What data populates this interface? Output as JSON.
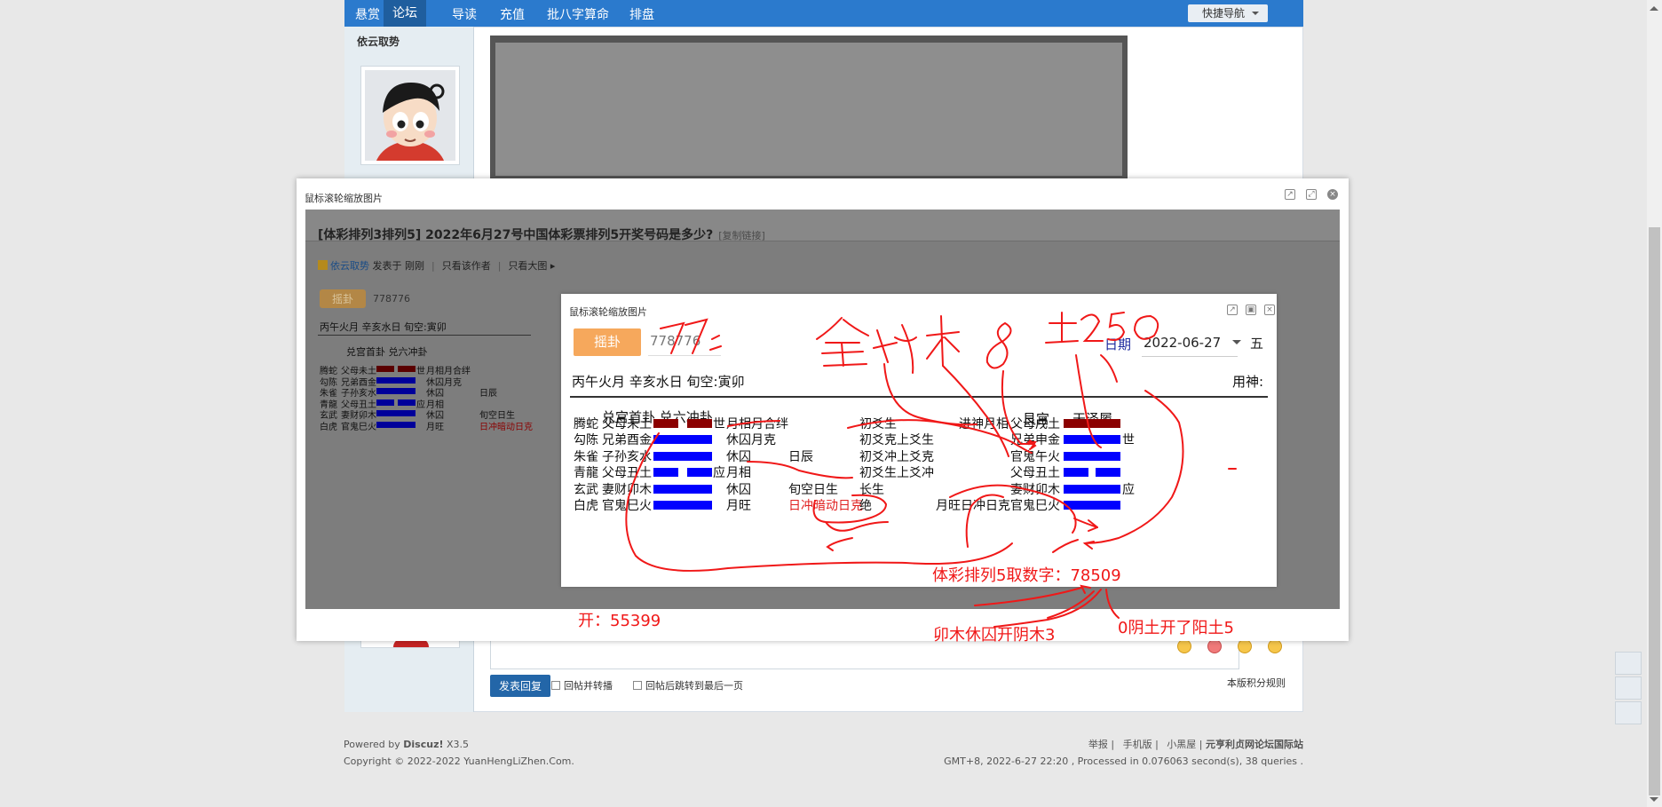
{
  "nav": {
    "items": [
      "悬赏",
      "论坛",
      "导读",
      "充值",
      "批八字算命",
      "排盘"
    ],
    "active_index": 1,
    "quick_nav": "快捷导航"
  },
  "sidebar": {
    "author": "依云取势"
  },
  "reply": {
    "submit": "发表回复",
    "opt1": "回帖并转播",
    "opt2": "回帖后跳转到最后一页",
    "rules": "本版积分规则"
  },
  "footer": {
    "powered_prefix": "Powered by ",
    "powered_name": "Discuz!",
    "powered_ver": " X3.5",
    "copyright": "Copyright © 2022-2022 YuanHengLiZhen.Com.",
    "links": [
      "举报",
      "手机版",
      "小黑屋",
      "元亨利贞网论坛国际站"
    ],
    "stats": "GMT+8, 2022-6-27 22:20 , Processed in 0.076063 second(s), 38 queries ."
  },
  "outer_dialog": {
    "title": "鼠标滚轮缩放图片",
    "post_title": "[体彩排列3排列5] 2022年6月27号中国体彩票排列5开奖号码是多少?",
    "copy_link": "[复制链接]",
    "author": "依云取势",
    "posted": "发表于 刚刚",
    "only_author": "只看该作者",
    "only_big": "只看大图",
    "yaogua": "摇卦",
    "number": "778776",
    "line1": "丙午火月 辛亥水日 旬空:寅卯",
    "gong": "兑宫首卦 兑六冲卦",
    "rows": [
      [
        "腾蛇",
        "父母未土",
        "世",
        "月相月合绊"
      ],
      [
        "勾陈",
        "兄弟酉金",
        "",
        "休囚月克"
      ],
      [
        "朱雀",
        "子孙亥水",
        "",
        "休囚",
        "日辰"
      ],
      [
        "青龍",
        "父母丑土",
        "应",
        "月相"
      ],
      [
        "玄武",
        "妻财卯木",
        "",
        "休囚",
        "旬空日生"
      ],
      [
        "白虎",
        "官鬼巳火",
        "",
        "月旺",
        "日冲暗动日克"
      ]
    ]
  },
  "inner_dialog": {
    "title": "鼠标滚轮缩放图片",
    "yaogua": "摇卦",
    "number": "778776",
    "date_label": "日期",
    "date": "2022-06-27",
    "five": "五",
    "line1": "丙午火月 辛亥水日 旬空:寅卯",
    "yongshen": "用神:",
    "gong_left": "兑宫首卦 兑六冲卦",
    "gong_right_1": "艮宫",
    "gong_right_2": "天泽履",
    "rows": [
      {
        "beast": "腾蛇",
        "rel": "父母未土",
        "bar": "yin-red",
        "shi": "世",
        "state": "月相月合绊",
        "day": "",
        "change": "初爻生",
        "mark": "进神月相",
        "rrel": "父母戌土",
        "rbar": "yang-red",
        "rshi": ""
      },
      {
        "beast": "勾陈",
        "rel": "兄弟酉金",
        "bar": "yang-blue",
        "shi": "",
        "state": "休囚月克",
        "day": "",
        "change": "初爻克上爻生",
        "mark": "",
        "rrel": "兄弟申金",
        "rbar": "yang-blue",
        "rshi": "世"
      },
      {
        "beast": "朱雀",
        "rel": "子孙亥水",
        "bar": "yang-blue",
        "shi": "",
        "state": "休囚",
        "day": "日辰",
        "change": "初爻冲上爻克",
        "mark": "",
        "rrel": "官鬼午火",
        "rbar": "yang-blue",
        "rshi": ""
      },
      {
        "beast": "青龍",
        "rel": "父母丑土",
        "bar": "yin-blue",
        "shi": "应",
        "state": "月相",
        "day": "",
        "change": "初爻生上爻冲",
        "mark": "",
        "rrel": "父母丑土",
        "rbar": "yin-blue",
        "rshi": ""
      },
      {
        "beast": "玄武",
        "rel": "妻财卯木",
        "bar": "yang-blue",
        "shi": "",
        "state": "休囚",
        "day": "旬空日生",
        "change": "长生",
        "mark": "",
        "rrel": "妻财卯木",
        "rbar": "yang-blue",
        "rshi": "应"
      },
      {
        "beast": "白虎",
        "rel": "官鬼巳火",
        "bar": "yang-blue",
        "shi": "",
        "state": "月旺",
        "day": "日冲暗动日克",
        "change": "绝",
        "mark": "月旺日冲日克",
        "rrel": "官鬼巳火",
        "rbar": "yang-blue",
        "rshi": ""
      }
    ]
  },
  "annotations": {
    "result": "体彩排列5取数字：78509",
    "open": "开：55399",
    "mao": "卯木休囚开阴木3",
    "zero": "0阴土开了阳土5",
    "dash": "-"
  },
  "colors": {
    "nav": "#2b7acd",
    "annotation": "#f01818",
    "yin_yang_red": "#8b0000",
    "yin_yang_blue": "#0000ff",
    "yaogua": "#f6a85c"
  }
}
